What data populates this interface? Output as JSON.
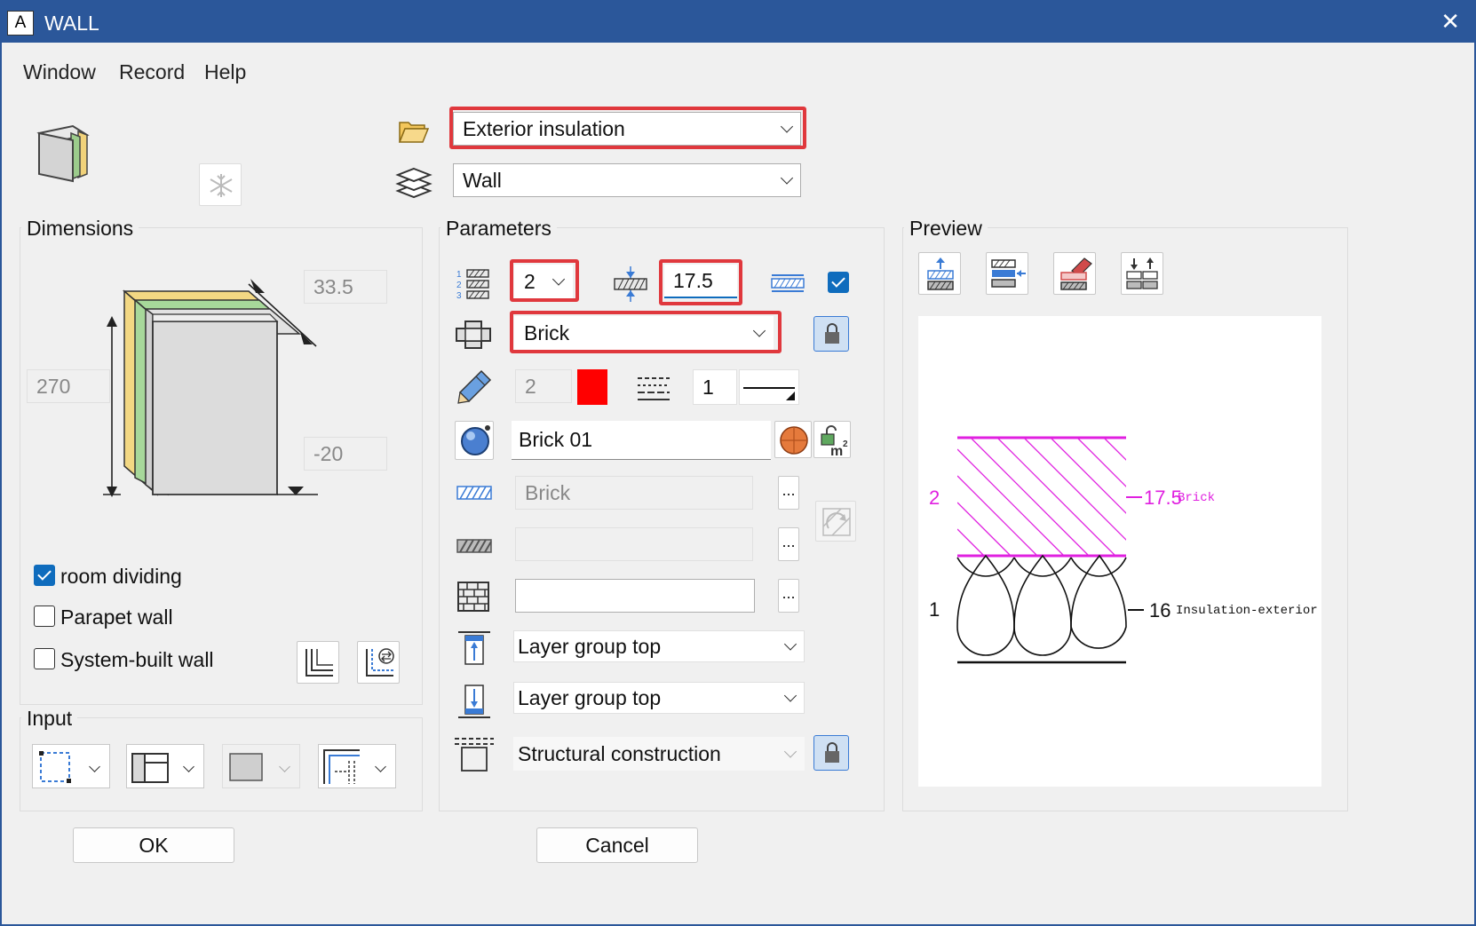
{
  "window": {
    "app_icon": "A",
    "title": "WALL",
    "close": "✕"
  },
  "menu": [
    "Window",
    "Record",
    "Help"
  ],
  "top": {
    "category": "Exterior insulation",
    "element": "Wall"
  },
  "dimensions": {
    "title": "Dimensions",
    "thickness": "33.5",
    "height": "270",
    "offset": "-20",
    "room_dividing": "room dividing",
    "parapet_wall": "Parapet wall",
    "system_built_wall": "System-built wall"
  },
  "input": {
    "title": "Input"
  },
  "parameters": {
    "title": "Parameters",
    "layer_number": "2",
    "layer_thickness": "17.5",
    "material": "Brick",
    "pen": "2",
    "pen_color": "#ff0000",
    "line_number": "1",
    "surface": "Brick 01",
    "hatching": "Brick",
    "pattern": "",
    "fill": "",
    "top_attach": "Layer group top",
    "bottom_attach": "Layer group top",
    "construction": "Structural construction",
    "dots": "..."
  },
  "preview": {
    "title": "Preview",
    "layer2_num": "2",
    "layer2_thick": "17.5",
    "layer2_name": "Brick",
    "layer1_num": "1",
    "layer1_thick": "16",
    "layer1_name": "Insulation-exterior"
  },
  "buttons": {
    "ok": "OK",
    "cancel": "Cancel"
  }
}
